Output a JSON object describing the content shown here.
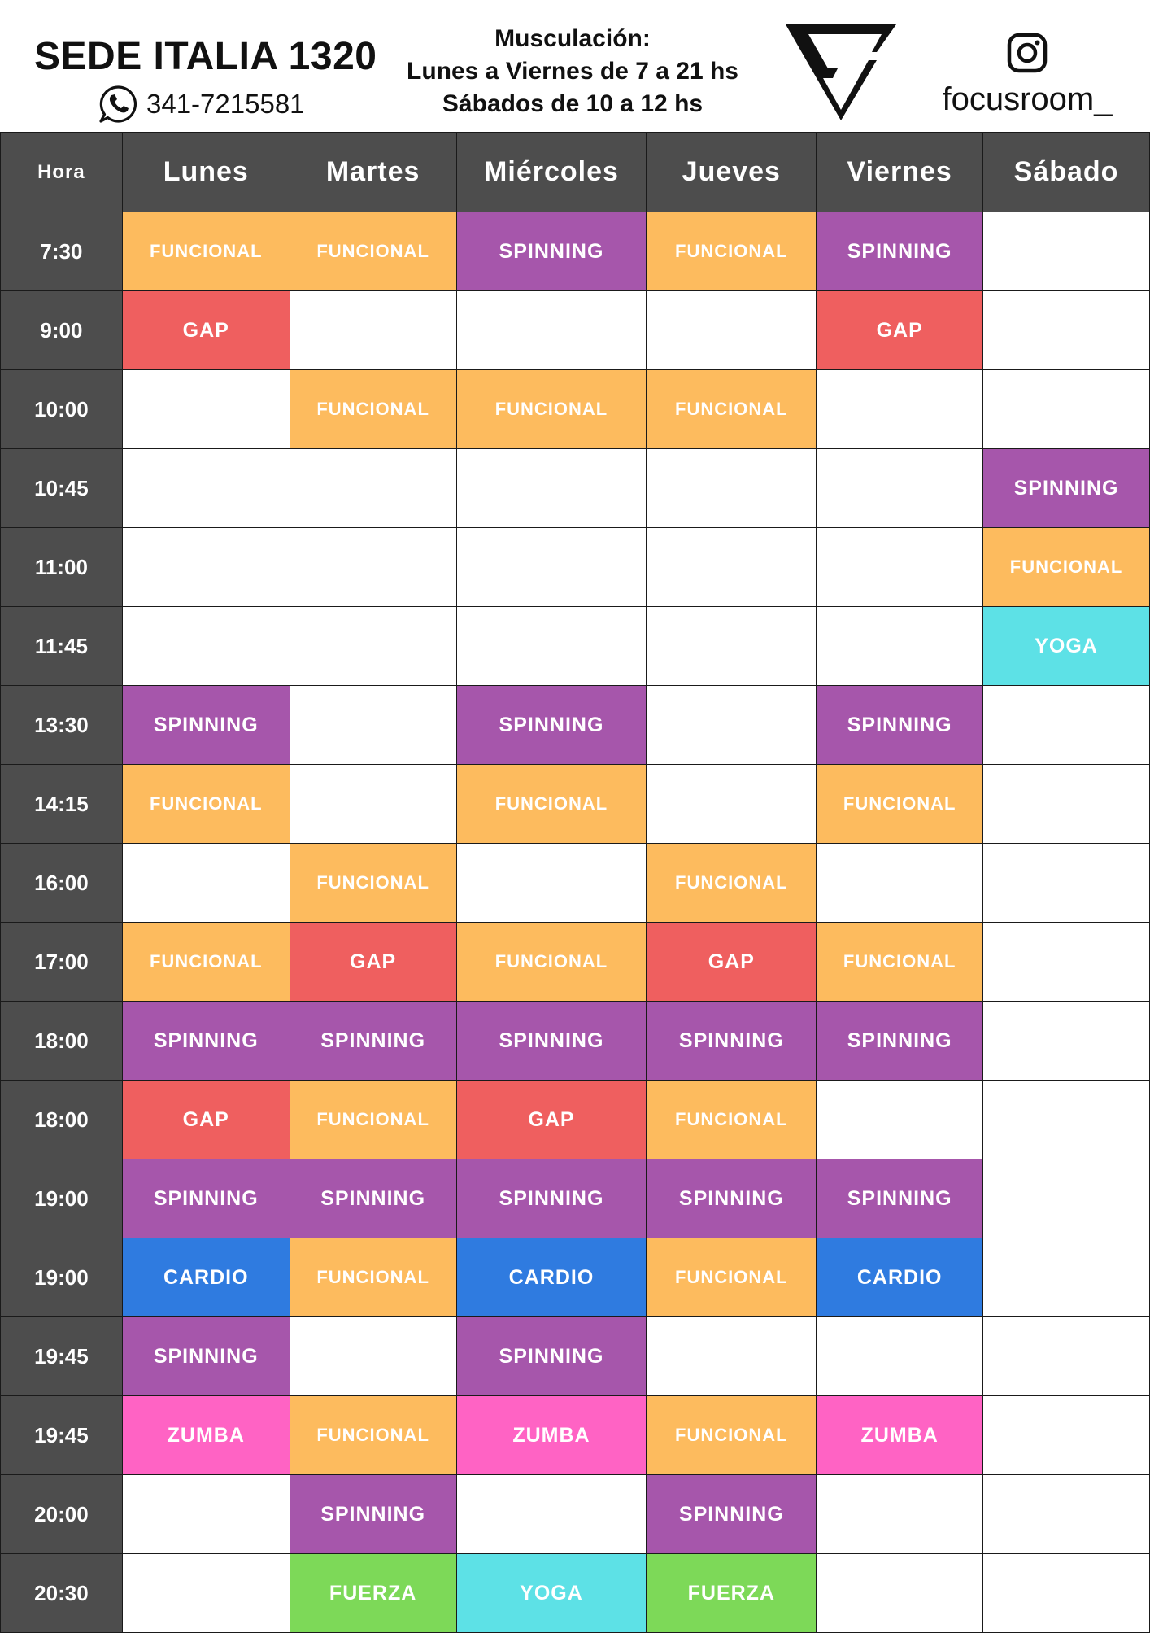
{
  "header": {
    "location_title": "SEDE ITALIA 1320",
    "phone": "341-7215581",
    "musculacion_label": "Musculación:",
    "weekday_hours": "Lunes a Viernes de 7 a 21 hs",
    "saturday_hours": "Sábados de 10 a 12 hs",
    "instagram_handle": "focusroom_"
  },
  "colors": {
    "header_dark": "#4d4d4d",
    "FUNCIONAL": "#fdbb5e",
    "SPINNING": "#a656ab",
    "GAP": "#ef5f5f",
    "CARDIO": "#2f7be0",
    "ZUMBA": "#ff63c4",
    "YOGA": "#5de1e6",
    "FUERZA": "#7dd958"
  },
  "icons": {
    "phone": "whatsapp-icon",
    "social": "instagram-icon",
    "brand": "focus-room-logo"
  },
  "table": {
    "hora_label": "Hora",
    "days": [
      "Lunes",
      "Martes",
      "Miércoles",
      "Jueves",
      "Viernes",
      "Sábado"
    ],
    "rows": [
      {
        "time": "7:30",
        "classes": [
          "FUNCIONAL",
          "FUNCIONAL",
          "SPINNING",
          "FUNCIONAL",
          "SPINNING",
          ""
        ]
      },
      {
        "time": "9:00",
        "classes": [
          "GAP",
          "",
          "",
          "",
          "GAP",
          ""
        ]
      },
      {
        "time": "10:00",
        "classes": [
          "",
          "FUNCIONAL",
          "FUNCIONAL",
          "FUNCIONAL",
          "",
          ""
        ]
      },
      {
        "time": "10:45",
        "classes": [
          "",
          "",
          "",
          "",
          "",
          "SPINNING"
        ]
      },
      {
        "time": "11:00",
        "classes": [
          "",
          "",
          "",
          "",
          "",
          "FUNCIONAL"
        ]
      },
      {
        "time": "11:45",
        "classes": [
          "",
          "",
          "",
          "",
          "",
          "YOGA"
        ]
      },
      {
        "time": "13:30",
        "classes": [
          "SPINNING",
          "",
          "SPINNING",
          "",
          "SPINNING",
          ""
        ]
      },
      {
        "time": "14:15",
        "classes": [
          "FUNCIONAL",
          "",
          "FUNCIONAL",
          "",
          "FUNCIONAL",
          ""
        ]
      },
      {
        "time": "16:00",
        "classes": [
          "",
          "FUNCIONAL",
          "",
          "FUNCIONAL",
          "",
          ""
        ]
      },
      {
        "time": "17:00",
        "classes": [
          "FUNCIONAL",
          "GAP",
          "FUNCIONAL",
          "GAP",
          "FUNCIONAL",
          ""
        ]
      },
      {
        "time": "18:00",
        "classes": [
          "SPINNING",
          "SPINNING",
          "SPINNING",
          "SPINNING",
          "SPINNING",
          ""
        ]
      },
      {
        "time": "18:00",
        "classes": [
          "GAP",
          "FUNCIONAL",
          "GAP",
          "FUNCIONAL",
          "",
          ""
        ]
      },
      {
        "time": "19:00",
        "classes": [
          "SPINNING",
          "SPINNING",
          "SPINNING",
          "SPINNING",
          "SPINNING",
          ""
        ]
      },
      {
        "time": "19:00",
        "classes": [
          "CARDIO",
          "FUNCIONAL",
          "CARDIO",
          "FUNCIONAL",
          "CARDIO",
          ""
        ]
      },
      {
        "time": "19:45",
        "classes": [
          "SPINNING",
          "",
          "SPINNING",
          "",
          "",
          ""
        ]
      },
      {
        "time": "19:45",
        "classes": [
          "ZUMBA",
          "FUNCIONAL",
          "ZUMBA",
          "FUNCIONAL",
          "ZUMBA",
          ""
        ]
      },
      {
        "time": "20:00",
        "classes": [
          "",
          "SPINNING",
          "",
          "SPINNING",
          "",
          ""
        ]
      },
      {
        "time": "20:30",
        "classes": [
          "",
          "FUERZA",
          "YOGA",
          "FUERZA",
          "",
          ""
        ]
      }
    ]
  }
}
